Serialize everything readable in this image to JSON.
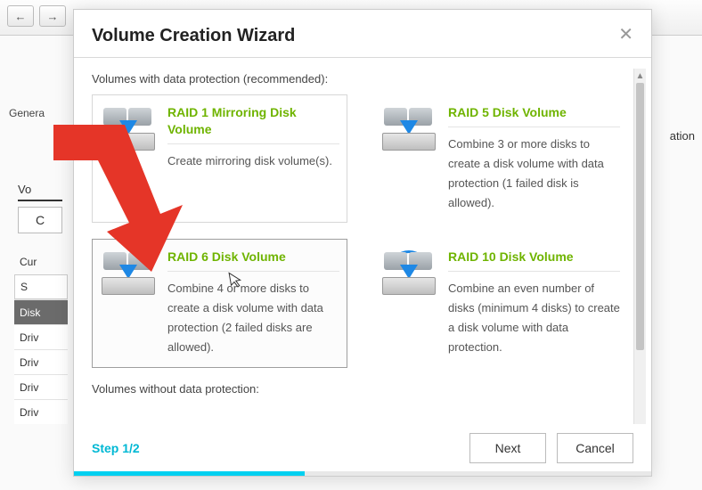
{
  "bg": {
    "general_label": "Genera",
    "right_label": "ation",
    "tab_label": "Vo",
    "create_label": "C",
    "sidebar": {
      "current": "Cur",
      "select": "S",
      "disk": "Disk",
      "drive1": "Driv",
      "drive2": "Driv",
      "drive3": "Driv",
      "drive4": "Driv"
    }
  },
  "modal": {
    "title": "Volume Creation Wizard",
    "close": "✕",
    "section_protected": "Volumes with data protection (recommended):",
    "section_unprotected": "Volumes without data protection:",
    "options": {
      "raid1": {
        "title": "RAID 1 Mirroring Disk Volume",
        "desc": "Create mirroring disk volume(s)."
      },
      "raid5": {
        "title": "RAID 5 Disk Volume",
        "desc": "Combine 3 or more disks to create a disk volume with data protection (1 failed disk is allowed)."
      },
      "raid6": {
        "title": "RAID 6 Disk Volume",
        "desc": "Combine 4 or more disks to create a disk volume with data protection (2 failed disks are allowed)."
      },
      "raid10": {
        "title": "RAID 10 Disk Volume",
        "desc": "Combine an even number of disks (minimum 4 disks) to create a disk volume with data protection."
      }
    },
    "step": "Step 1/2",
    "next": "Next",
    "cancel": "Cancel"
  },
  "colors": {
    "accent_green": "#6fb400",
    "accent_cyan": "#00d0f0",
    "arrow_red": "#e53528"
  }
}
